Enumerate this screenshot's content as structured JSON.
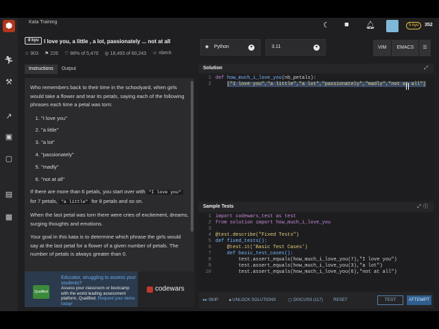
{
  "header": {
    "breadcrumb": "Kata Training",
    "kyu_badge": "8 kyu",
    "title": "I love you, a little , a lot, passionately ... not at all",
    "stats": {
      "stars": "903",
      "collections": "226",
      "satisfaction": "88% of 5,470",
      "completions": "18,493 of 60,243",
      "author": "nbeck"
    },
    "user": {
      "rank_badge": "5 kyu",
      "honor": "352"
    }
  },
  "left_panel": {
    "tabs": [
      "Instructions",
      "Output"
    ],
    "active_tab": "Instructions",
    "intro": "Who remembers back to their time in the schoolyard, when girls would take a flower and tear its petals, saying each of the following phrases each time a petal was torn:",
    "phrases": [
      "\"I love you\"",
      "\"a little\"",
      "\"a lot\"",
      "\"passionately\"",
      "\"madly\"",
      "\"not at all\""
    ],
    "p2_a": "If there are more than 6 petals, you start over with ",
    "p2_code1": "\"I love you\"",
    "p2_b": " for 7 petals, ",
    "p2_code2": "\"a little\"",
    "p2_c": " for 8 petals and so on.",
    "p3": "When the last petal was torn there were cries of excitement, dreams, surging thoughts and emotions.",
    "p4": "Your goal in this kata is to determine which phrase the girls would say at the last petal for a flower of a given number of petals. The number of petals is always greater than 0."
  },
  "ad": {
    "logo_text": "Qualified",
    "headline": "Educator, struggling to assess your students?",
    "body": "Assess your classroom or bootcamp with the world leading assessment platform, Qualified.",
    "link": "Request your demo today!",
    "brand": "codewars"
  },
  "editor_controls": {
    "language": "Python",
    "version": "3.11",
    "modes": [
      "VIM",
      "EMACS"
    ]
  },
  "solution": {
    "title": "Solution",
    "line_numbers": [
      "1",
      "2"
    ],
    "line1": {
      "kw": "def ",
      "fn": "how_much_i_love_you",
      "rest": "(nb_petals):"
    },
    "line2_indent": "    ",
    "line2_code": "[\"I love you\",\"a little\",\"a lot\",\"passionately\",\"madly\",\"not at all\"]"
  },
  "tests": {
    "title": "Sample Tests",
    "line_numbers": [
      "1",
      "2",
      "3",
      "4",
      "5",
      "6",
      "7",
      "8",
      "9",
      "10"
    ],
    "lines": [
      "import codewars_test as test",
      "from solution import how_much_i_love_you",
      "",
      "@test.describe(\"Fixed Tests\")",
      "def fixed_tests():",
      "    @test.it('Basic Test Cases')",
      "    def basic_test_cases():",
      "        test.assert_equals(how_much_i_love_you(7),\"I love you\")",
      "        test.assert_equals(how_much_i_love_you(3),\"a lot\")",
      "        test.assert_equals(how_much_i_love_you(6),\"not at all\")"
    ]
  },
  "toolbar": {
    "skip": "SKIP",
    "unlock": "UNLOCK SOLUTIONS",
    "discuss": "DISCUSS (117)",
    "reset": "RESET",
    "test": "TEST",
    "attempt": "ATTEMPT"
  },
  "colors": {
    "accent": "#b1361e",
    "primary_button": "#2f5f8f",
    "rank_badge": "#e8c13a"
  }
}
